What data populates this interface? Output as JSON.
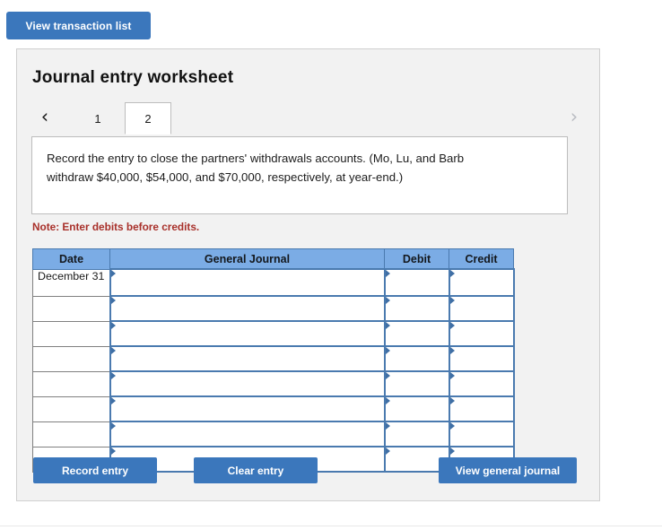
{
  "top": {
    "view_transaction_label": "View transaction list"
  },
  "panel": {
    "title": "Journal entry worksheet",
    "tabs": [
      {
        "label": "1",
        "active": false
      },
      {
        "label": "2",
        "active": true
      }
    ],
    "nav": {
      "prev_icon": "chevron-left-icon",
      "next_icon": "chevron-right-icon",
      "prev_glyph": "‹",
      "next_glyph": "›"
    },
    "instruction": "Record the entry to close the partners' withdrawals accounts. (Mo, Lu, and Barb withdraw $40,000, $54,000, and $70,000, respectively, at year-end.)",
    "note": "Note: Enter debits before credits."
  },
  "table": {
    "columns": [
      "Date",
      "General Journal",
      "Debit",
      "Credit"
    ],
    "rows": [
      {
        "date": "December 31",
        "journal": "",
        "debit": "",
        "credit": ""
      },
      {
        "date": "",
        "journal": "",
        "debit": "",
        "credit": ""
      },
      {
        "date": "",
        "journal": "",
        "debit": "",
        "credit": ""
      },
      {
        "date": "",
        "journal": "",
        "debit": "",
        "credit": ""
      },
      {
        "date": "",
        "journal": "",
        "debit": "",
        "credit": ""
      },
      {
        "date": "",
        "journal": "",
        "debit": "",
        "credit": ""
      },
      {
        "date": "",
        "journal": "",
        "debit": "",
        "credit": ""
      },
      {
        "date": "",
        "journal": "",
        "debit": "",
        "credit": ""
      }
    ]
  },
  "buttons": {
    "record": "Record entry",
    "clear": "Clear entry",
    "view_general_journal": "View general journal"
  },
  "colors": {
    "button_blue": "#3b77bc",
    "header_blue": "#7bace5",
    "cell_border_blue": "#4a7aaf",
    "panel_bg": "#f2f2f2",
    "note_red": "#a8302a"
  }
}
